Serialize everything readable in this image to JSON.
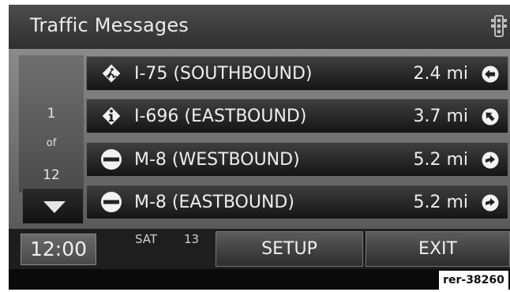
{
  "header": {
    "title": "Traffic Messages",
    "traffic_icon": "traffic-light-icon"
  },
  "pager": {
    "current": "1",
    "of": "of",
    "total": "12",
    "down_icon": "down-arrow-icon"
  },
  "messages": [
    {
      "icon": "roadwork-icon",
      "road": "I-75 (SOUTHBOUND)",
      "distance": "2.4 mi",
      "direction_icon": "direction-arrow-left-icon"
    },
    {
      "icon": "info-icon",
      "road": "I-696 (EASTBOUND)",
      "distance": "3.7 mi",
      "direction_icon": "direction-arrow-up-left-icon"
    },
    {
      "icon": "no-entry-icon",
      "road": "M-8 (WESTBOUND)",
      "distance": "5.2 mi",
      "direction_icon": "direction-arrow-right-icon"
    },
    {
      "icon": "no-entry-icon",
      "road": "M-8 (EASTBOUND)",
      "distance": "5.2 mi",
      "direction_icon": "direction-arrow-right-icon"
    }
  ],
  "footer": {
    "clock": "12:00",
    "day": "SAT",
    "date": "13",
    "setup_label": "SETUP",
    "exit_label": "EXIT"
  },
  "reference": "rer-38260"
}
